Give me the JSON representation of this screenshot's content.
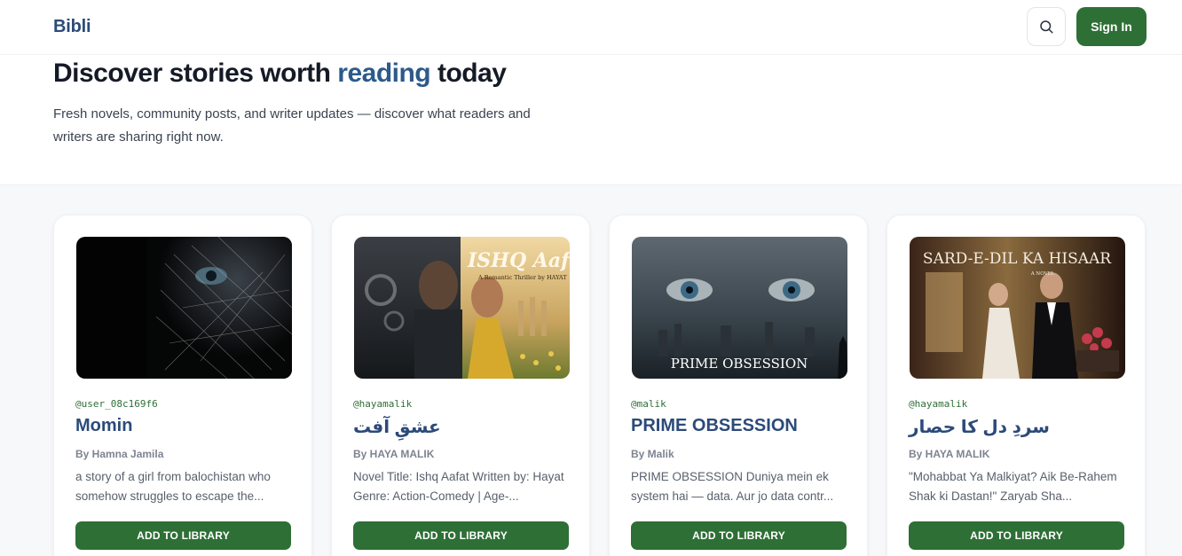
{
  "header": {
    "logo": "Bibli",
    "search_icon": "search-icon",
    "signin_label": "Sign In"
  },
  "hero": {
    "title_before": "Discover stories worth ",
    "title_accent": "reading",
    "title_after": " today",
    "subtitle": "Fresh novels, community posts, and writer updates — discover what readers and writers are sharing right now."
  },
  "cards": [
    {
      "handle": "@user_08c169f6",
      "title": "Momin",
      "author": "By Hamna Jamila",
      "description": "a story of a girl from balochistan who somehow struggles to escape the...",
      "button": "ADD TO LIBRARY",
      "cover_text": "",
      "cover_subtitle": ""
    },
    {
      "handle": "@hayamalik",
      "title": "عشقِ آفت",
      "author": "By HAYA MALIK",
      "description": "Novel Title: Ishq Aafat Written by: Hayat Genre: Action-Comedy | Age-...",
      "button": "ADD TO LIBRARY",
      "cover_text": "ISHQ Aafat",
      "cover_subtitle": "A Romantic Thriller by HAYAT"
    },
    {
      "handle": "@malik",
      "title": "PRIME OBSESSION",
      "author": "By Malik",
      "description": "PRIME OBSESSION Duniya mein ek system hai — data. Aur jo data contr...",
      "button": "ADD TO LIBRARY",
      "cover_text": "PRIME OBSESSION",
      "cover_subtitle": ""
    },
    {
      "handle": "@hayamalik",
      "title": "سردِ دل کا حصار",
      "author": "By HAYA MALIK",
      "description": "\"Mohabbat Ya Malkiyat? Aik Be-Rahem Shak ki Dastan!\" Zaryab Sha...",
      "button": "ADD TO LIBRARY",
      "cover_text": "SARD-E-DIL KA HISAAR",
      "cover_subtitle": "A NOVEL"
    }
  ],
  "colors": {
    "brand": "#2c4a7a",
    "accent_green": "#2e6f36",
    "feed_bg": "#f7f8fa"
  }
}
